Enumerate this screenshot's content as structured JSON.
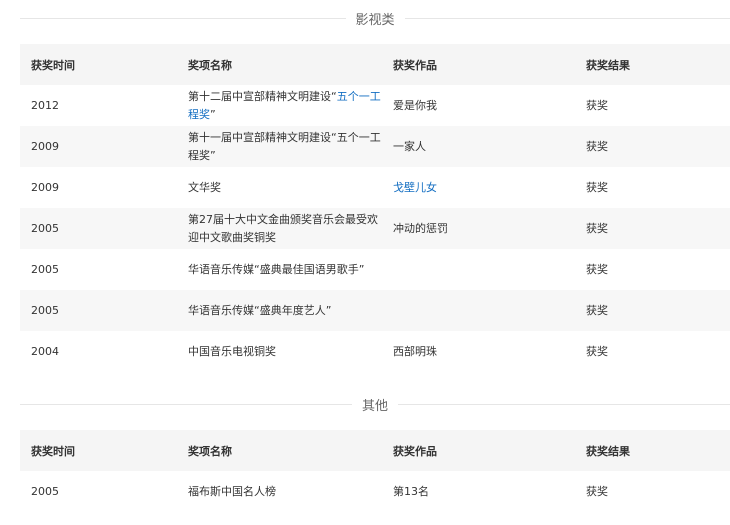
{
  "colors": {
    "link": "#136ec2",
    "header_bg": "#f5f5f5",
    "alt_row_bg": "#f7f7f7",
    "rule": "#e6e6e6"
  },
  "sections": [
    {
      "title": "影视类",
      "headers": [
        "获奖时间",
        "奖项名称",
        "获奖作品",
        "获奖结果"
      ],
      "rows": [
        {
          "year": "2012",
          "award_text": "第十二届中宣部精神文明建设“",
          "award_link": "五个一工程奖",
          "award_suffix": "”",
          "work": "爱是你我",
          "work_is_link": false,
          "result": "获奖"
        },
        {
          "year": "2009",
          "award_text": "第十一届中宣部精神文明建设“五个一工程奖”",
          "award_link": "",
          "award_suffix": "",
          "work": "一家人",
          "work_is_link": false,
          "result": "获奖"
        },
        {
          "year": "2009",
          "award_text": "文华奖",
          "award_link": "",
          "award_suffix": "",
          "work": "戈壁儿女",
          "work_is_link": true,
          "result": "获奖"
        },
        {
          "year": "2005",
          "award_text": "第27届十大中文金曲颁奖音乐会最受欢迎中文歌曲奖铜奖",
          "award_link": "",
          "award_suffix": "",
          "work": "冲动的惩罚",
          "work_is_link": false,
          "result": "获奖"
        },
        {
          "year": "2005",
          "award_text": "华语音乐传媒“盛典最佳国语男歌手”",
          "award_link": "",
          "award_suffix": "",
          "work": "",
          "work_is_link": false,
          "result": "获奖"
        },
        {
          "year": "2005",
          "award_text": "华语音乐传媒“盛典年度艺人”",
          "award_link": "",
          "award_suffix": "",
          "work": "",
          "work_is_link": false,
          "result": "获奖"
        },
        {
          "year": "2004",
          "award_text": "中国音乐电视铜奖",
          "award_link": "",
          "award_suffix": "",
          "work": "西部明珠",
          "work_is_link": false,
          "result": "获奖"
        }
      ]
    },
    {
      "title": "其他",
      "headers": [
        "获奖时间",
        "奖项名称",
        "获奖作品",
        "获奖结果"
      ],
      "rows": [
        {
          "year": "2005",
          "award_text": "福布斯中国名人榜",
          "award_link": "",
          "award_suffix": "",
          "work": "第13名",
          "work_is_link": false,
          "result": "获奖"
        }
      ]
    }
  ]
}
